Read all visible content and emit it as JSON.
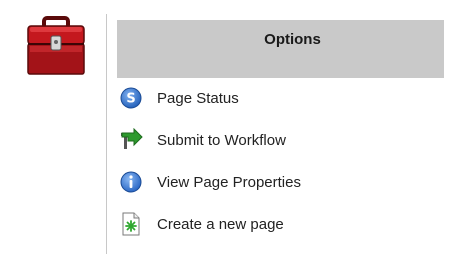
{
  "header": {
    "title": "Options"
  },
  "toolbox_icon": "toolbox-icon",
  "menu": {
    "items": [
      {
        "label": "Page Status",
        "icon": "status-icon"
      },
      {
        "label": "Submit to Workflow",
        "icon": "workflow-arrow-icon"
      },
      {
        "label": "View Page Properties",
        "icon": "info-icon"
      },
      {
        "label": "Create a new page",
        "icon": "new-page-icon"
      }
    ]
  },
  "colors": {
    "header_bg": "#c9c9c9",
    "status_blue": "#2f6fcf",
    "workflow_green": "#2e8b2e",
    "toolbox_red": "#b3161b"
  }
}
